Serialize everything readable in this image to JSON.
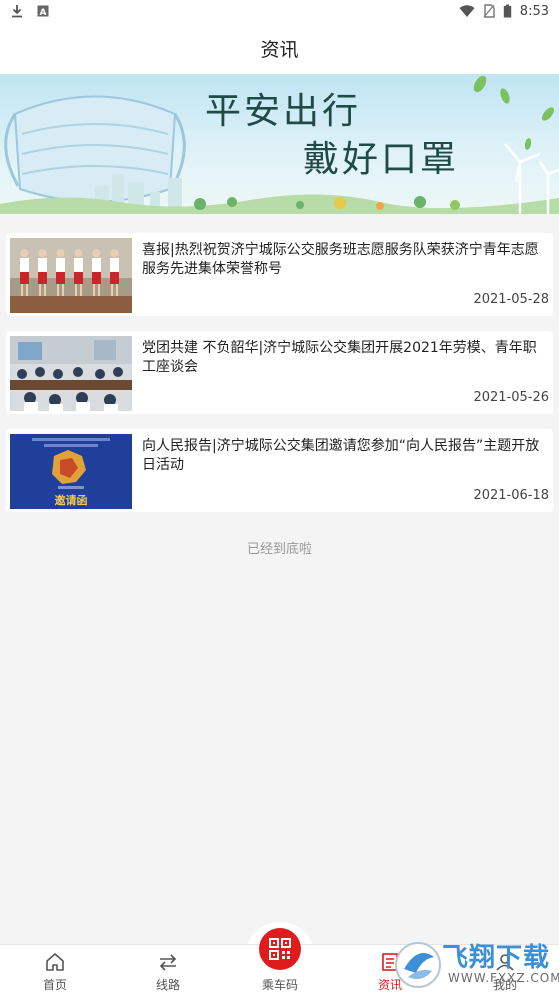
{
  "status_bar": {
    "time": "8:53",
    "left_icons": [
      "download-icon",
      "notification-a-icon"
    ],
    "right_icons": [
      "wifi-icon",
      "sim-icon",
      "battery-icon"
    ]
  },
  "header": {
    "title": "资讯"
  },
  "banner": {
    "line1": "平安出行",
    "line2": "戴好口罩",
    "colors": {
      "sky": "#bfe5f3",
      "text": "#1f4a46"
    }
  },
  "news": [
    {
      "title": "喜报|热烈祝贺济宁城际公交服务班志愿服务队荣获济宁青年志愿服务先进集体荣誉称号",
      "date": "2021-05-28",
      "thumb": "photo-volunteers"
    },
    {
      "title": "党团共建 不负韶华|济宁城际公交集团开展2021年劳模、青年职工座谈会",
      "date": "2021-05-26",
      "thumb": "photo-meeting"
    },
    {
      "title": "向人民报告|济宁城际公交集团邀请您参加“向人民报告”主题开放日活动",
      "date": "2021-06-18",
      "thumb": "invitation-card",
      "thumb_caption": "邀请函"
    }
  ],
  "end_text": "已经到底啦",
  "tabbar": {
    "tabs": [
      {
        "label": "首页",
        "icon": "home-icon",
        "active": false
      },
      {
        "label": "线路",
        "icon": "swap-route-icon",
        "active": false
      },
      {
        "label": "乘车码",
        "icon": "qr-code-icon",
        "active": false
      },
      {
        "label": "资讯",
        "icon": "news-icon",
        "active": true
      },
      {
        "label": "我的",
        "icon": "user-icon",
        "active": false
      }
    ],
    "accent": "#d81e1e"
  },
  "watermark": {
    "brand": "飞翔下载",
    "url": "WWW.FXXZ.COM"
  }
}
